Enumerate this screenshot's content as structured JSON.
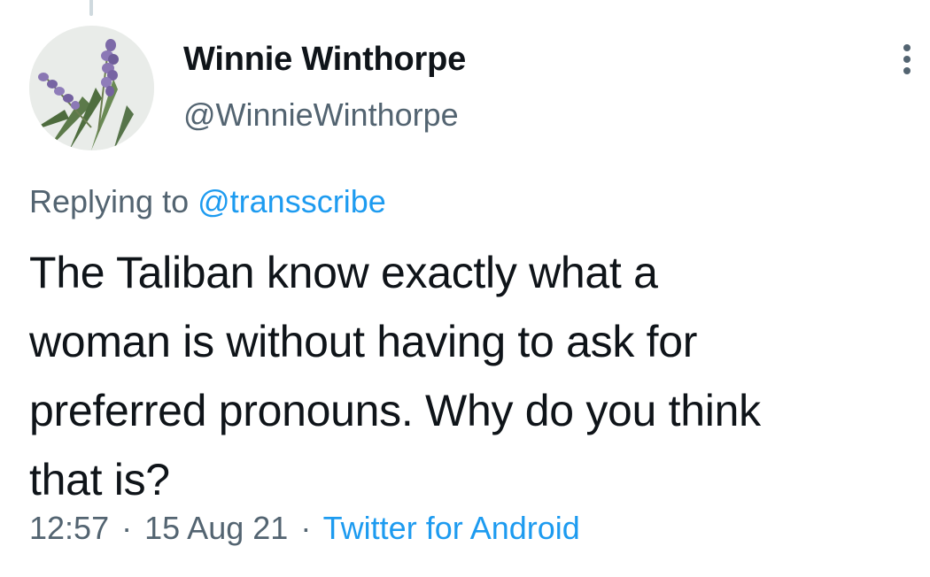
{
  "tweet": {
    "author": {
      "display_name": "Winnie Winthorpe",
      "handle": "@WinnieWinthorpe",
      "avatar_icon": "lavender-flower-avatar"
    },
    "replying_to": {
      "prefix": "Replying to",
      "mention": "@transscribe"
    },
    "text_lines": [
      "The Taliban know exactly what a",
      "woman is without having to ask for",
      "preferred pronouns. Why do you think",
      "that is?"
    ],
    "meta": {
      "time": "12:57",
      "separator": "·",
      "date": "15 Aug 21",
      "source": "Twitter for Android"
    },
    "more_icon": "more-vertical-icon"
  },
  "colors": {
    "text": "#0f1419",
    "secondary": "#536471",
    "link": "#1d9bf0",
    "thread_line": "#cfd9de"
  }
}
